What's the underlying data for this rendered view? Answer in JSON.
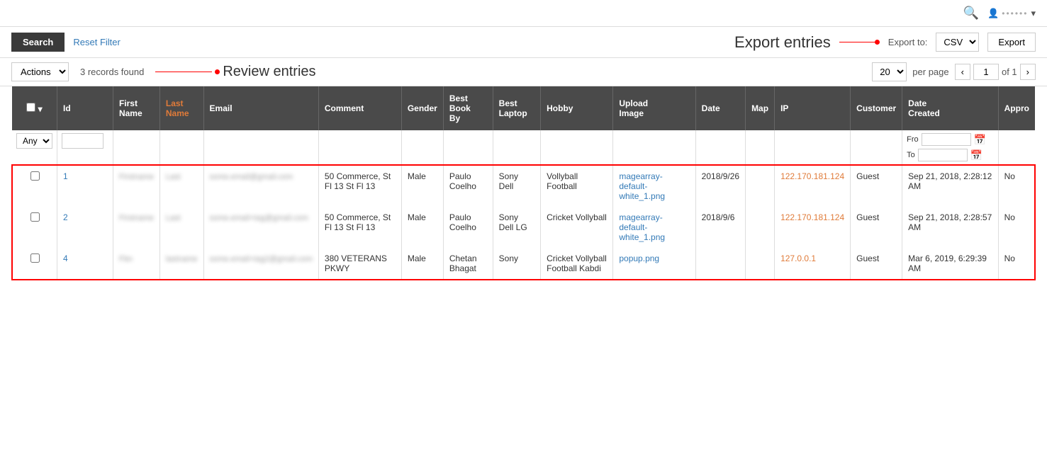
{
  "topbar": {
    "search_icon": "🔍",
    "user_icon": "👤",
    "user_name": "••••••",
    "dropdown_icon": "▾"
  },
  "toolbar": {
    "search_label": "Search",
    "reset_label": "Reset Filter",
    "export_entries_label": "Export entries",
    "export_to_label": "Export to:",
    "export_format": "CSV",
    "export_button_label": "Export"
  },
  "sub_toolbar": {
    "actions_label": "Actions",
    "records_found": "3 records found",
    "review_label": "Review entries",
    "per_page": "20",
    "per_page_label": "per page",
    "current_page": "1",
    "total_pages": "of 1"
  },
  "table": {
    "headers": [
      "",
      "Id",
      "First Name",
      "Last Name",
      "Email",
      "Comment",
      "Gender",
      "Best Book By",
      "Best Laptop",
      "Hobby",
      "Upload Image",
      "Date",
      "Map",
      "IP",
      "Customer",
      "Date Created",
      "Appro"
    ],
    "filter": {
      "any_label": "Any",
      "id_placeholder": ""
    },
    "rows": [
      {
        "id": "1",
        "first_name": "Firstname",
        "last_name": "Last",
        "email": "some.email@gmail.com",
        "comment": "50 Commerce, St Fl 13 St Fl 13",
        "gender": "Male",
        "best_book_by": "Paulo Coelho",
        "best_laptop": "Sony Dell",
        "hobby": "Vollyball Football",
        "upload_image": "magearray-default-white_1.png",
        "date": "2018/9/26",
        "map": "",
        "ip": "122.170.181.124",
        "customer": "Guest",
        "date_created": "Sep 21, 2018, 2:28:12 AM",
        "approved": "No"
      },
      {
        "id": "2",
        "first_name": "Firstname",
        "last_name": "Last",
        "email": "some.email+tag@gmail.com",
        "comment": "50 Commerce, St Fl 13 St Fl 13",
        "gender": "Male",
        "best_book_by": "Paulo Coelho",
        "best_laptop": "Sony Dell LG",
        "hobby": "Cricket Vollyball",
        "upload_image": "magearray-default-white_1.png",
        "date": "2018/9/6",
        "map": "",
        "ip": "122.170.181.124",
        "customer": "Guest",
        "date_created": "Sep 21, 2018, 2:28:57 AM",
        "approved": "No"
      },
      {
        "id": "4",
        "first_name": "Fbn",
        "last_name": "lastname",
        "email": "some.email+tag2@gmail.com",
        "comment": "380 VETERANS PKWY",
        "gender": "Male",
        "best_book_by": "Chetan Bhagat",
        "best_laptop": "Sony",
        "hobby": "Cricket Vollyball Football Kabdi",
        "upload_image": "popup.png",
        "date": "",
        "map": "",
        "ip": "127.0.0.1",
        "customer": "Guest",
        "date_created": "Mar 6, 2019, 6:29:39 AM",
        "approved": "No"
      }
    ]
  }
}
